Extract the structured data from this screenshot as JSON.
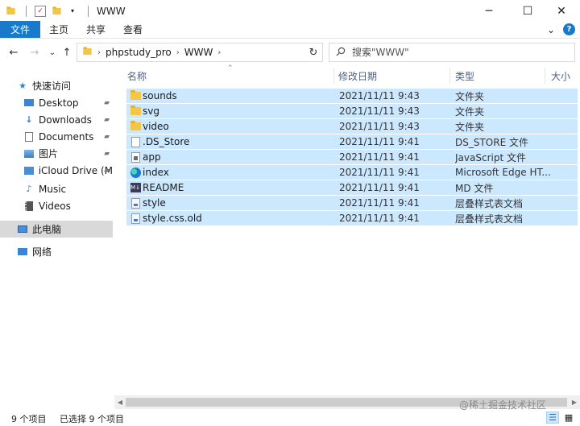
{
  "window": {
    "title": "WWW",
    "minimize_glyph": "─",
    "maximize_glyph": "☐",
    "close_glyph": "✕"
  },
  "ribbon": {
    "tabs": [
      {
        "label": "文件",
        "active": true
      },
      {
        "label": "主页",
        "active": false
      },
      {
        "label": "共享",
        "active": false
      },
      {
        "label": "查看",
        "active": false
      }
    ],
    "expand_glyph": "⌄",
    "help_glyph": "?"
  },
  "navigation": {
    "back_glyph": "←",
    "forward_glyph": "→",
    "recent_glyph": "⌄",
    "up_glyph": "↑",
    "refresh_glyph": "↻"
  },
  "address": {
    "path": [
      "phpstudy_pro",
      "WWW"
    ],
    "separator": "›"
  },
  "search": {
    "placeholder": "搜索\"WWW\""
  },
  "sidebar": {
    "quick_access": "快速访问",
    "items": [
      {
        "label": "Desktop",
        "icon": "desktop-icon",
        "pinned": true
      },
      {
        "label": "Downloads",
        "icon": "downloads-icon",
        "pinned": true
      },
      {
        "label": "Documents",
        "icon": "documents-icon",
        "pinned": true
      },
      {
        "label": "图片",
        "icon": "pictures-icon",
        "pinned": true
      },
      {
        "label": "iCloud Drive (M",
        "icon": "icloud-icon",
        "pinned": true
      },
      {
        "label": "Music",
        "icon": "music-icon",
        "pinned": false
      },
      {
        "label": "Videos",
        "icon": "videos-icon",
        "pinned": false
      }
    ],
    "this_pc": "此电脑",
    "network": "网络",
    "pin_glyph": "📌"
  },
  "columns": {
    "name": "名称",
    "date": "修改日期",
    "type": "类型",
    "size": "大小"
  },
  "files": [
    {
      "name": "sounds",
      "date": "2021/11/11 9:43",
      "type": "文件夹",
      "icon": "folder-icon"
    },
    {
      "name": "svg",
      "date": "2021/11/11 9:43",
      "type": "文件夹",
      "icon": "folder-icon"
    },
    {
      "name": "video",
      "date": "2021/11/11 9:43",
      "type": "文件夹",
      "icon": "folder-icon"
    },
    {
      "name": ".DS_Store",
      "date": "2021/11/11 9:41",
      "type": "DS_STORE 文件",
      "icon": "file-icon"
    },
    {
      "name": "app",
      "date": "2021/11/11 9:41",
      "type": "JavaScript 文件",
      "icon": "js-file-icon"
    },
    {
      "name": "index",
      "date": "2021/11/11 9:41",
      "type": "Microsoft Edge HT...",
      "icon": "edge-html-icon"
    },
    {
      "name": "README",
      "date": "2021/11/11 9:41",
      "type": "MD 文件",
      "icon": "md-file-icon"
    },
    {
      "name": "style",
      "date": "2021/11/11 9:41",
      "type": "层叠样式表文档",
      "icon": "css-file-icon"
    },
    {
      "name": "style.css.old",
      "date": "2021/11/11 9:41",
      "type": "层叠样式表文档",
      "icon": "css-file-icon"
    }
  ],
  "status": {
    "item_count": "9 个项目",
    "selected_count": "已选择 9 个项目"
  },
  "watermark": "@稀土掘金技术社区",
  "colors": {
    "accent": "#1979ca",
    "selection": "#cce8ff",
    "header_text": "#4d6082"
  }
}
